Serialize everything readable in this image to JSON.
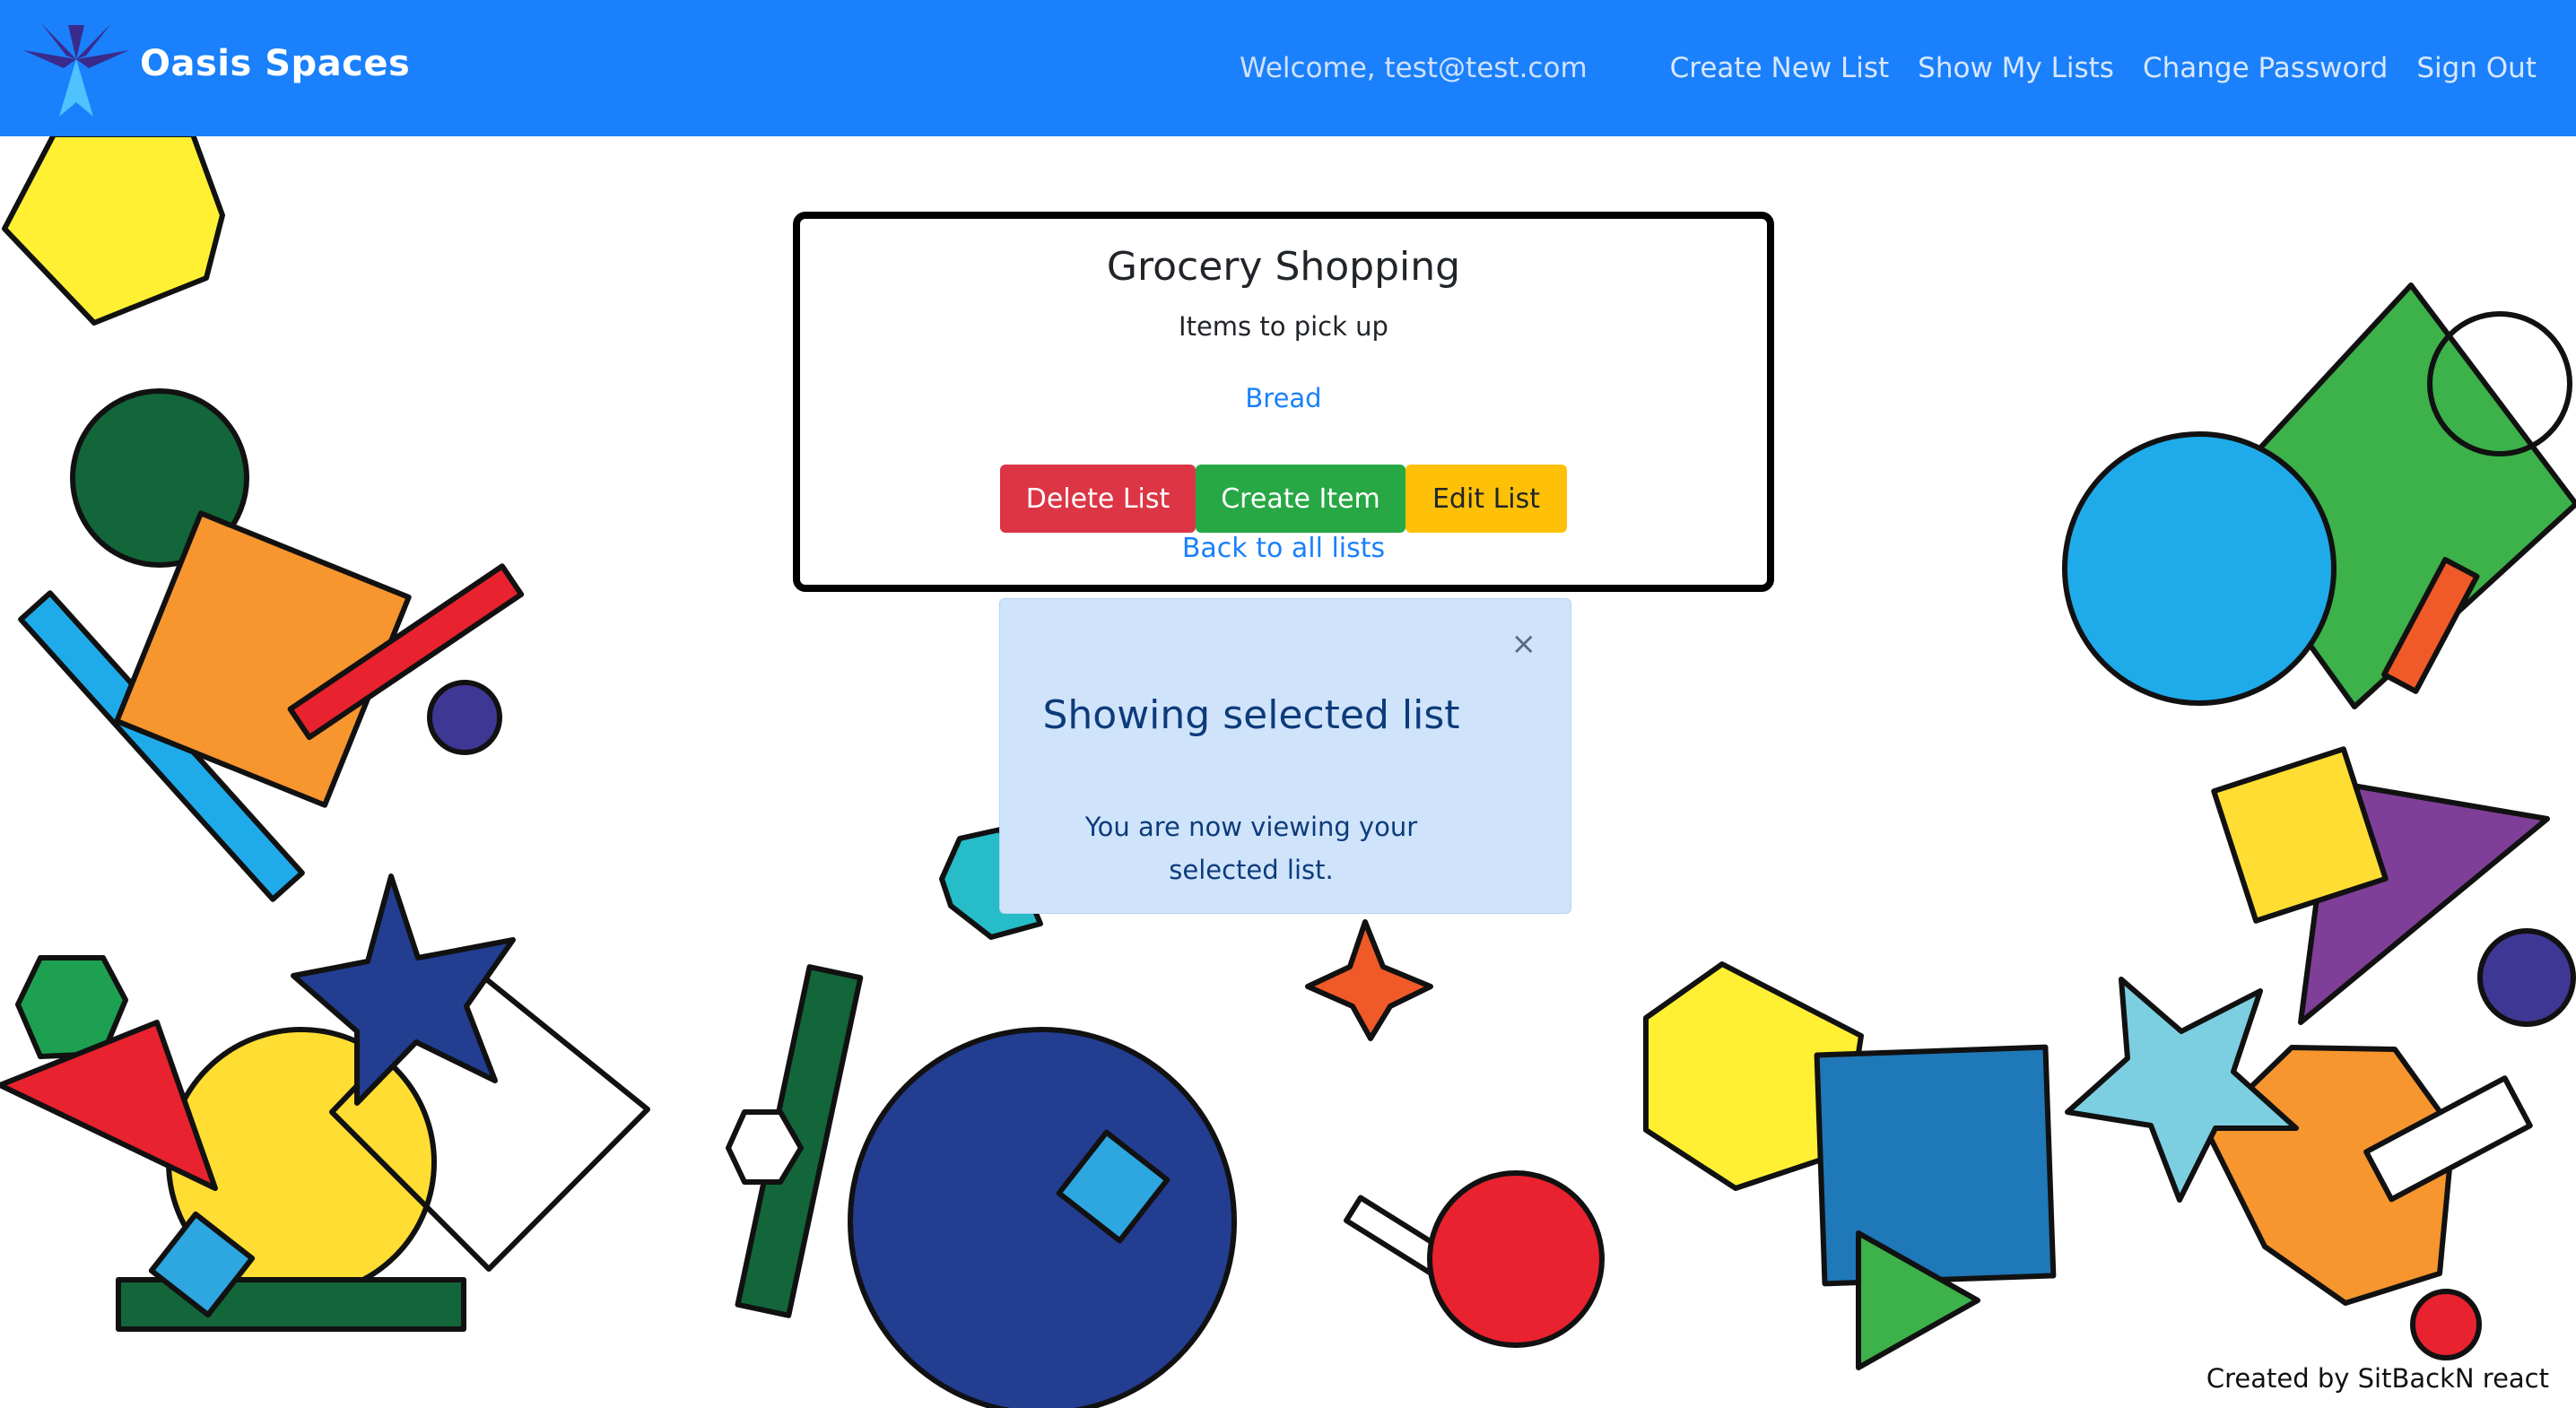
{
  "header": {
    "brand_name": "Oasis Spaces",
    "welcome": "Welcome, test@test.com",
    "nav": [
      "Create New List",
      "Show My Lists",
      "Change Password",
      "Sign Out"
    ]
  },
  "list": {
    "title": "Grocery Shopping",
    "subtitle": "Items to pick up",
    "items": [
      "Bread"
    ],
    "buttons": {
      "delete": "Delete List",
      "create": "Create Item",
      "edit": "Edit List"
    },
    "back_link": "Back to all lists"
  },
  "toast": {
    "close": "×",
    "heading": "Showing selected list",
    "body": "You are now viewing your selected list."
  },
  "footer": "Created by SitBackN react",
  "colors": {
    "navbar": "#1a80fb",
    "danger": "#dc3545",
    "success": "#28a745",
    "warning": "#ffc107",
    "toast_bg": "#cfe4fb"
  },
  "icons": {
    "brand": "palm-tree-logo-icon",
    "close": "close-icon"
  }
}
